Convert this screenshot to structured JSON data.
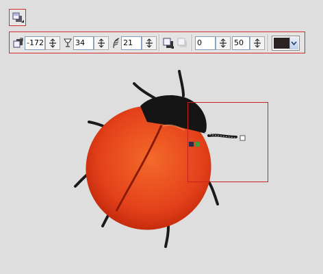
{
  "toolbar": {
    "fields": [
      {
        "icon": "shadow-offset-icon",
        "value": "-172"
      },
      {
        "icon": "goblet-icon",
        "value": "34"
      },
      {
        "icon": "feather-icon",
        "value": "21"
      },
      {
        "icon": "opacity-icon",
        "value": "0"
      },
      {
        "icon": "blur-icon",
        "value": "50"
      }
    ],
    "shadow_color": "#2b2323"
  },
  "colors": {
    "background": "#dedede",
    "selection": "#cc1f1f",
    "shell": "#e8451a",
    "shell_dark": "#b42206",
    "head": "#151515"
  }
}
